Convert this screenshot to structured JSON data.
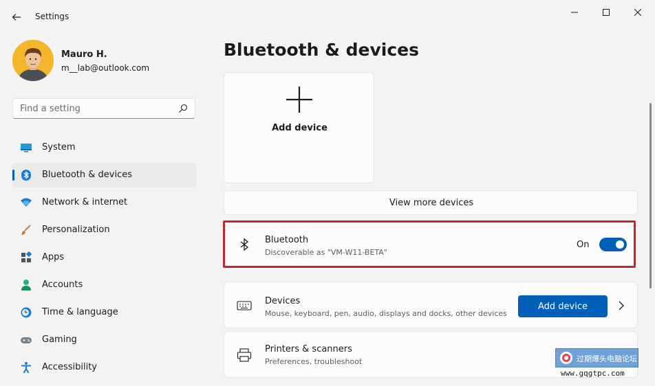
{
  "window": {
    "title": "Settings"
  },
  "profile": {
    "name": "Mauro H.",
    "email": "m__lab@outlook.com"
  },
  "search": {
    "placeholder": "Find a setting",
    "icon": "search-icon"
  },
  "nav": {
    "items": [
      {
        "label": "System",
        "icon": "monitor-icon",
        "active": false
      },
      {
        "label": "Bluetooth & devices",
        "icon": "bluetooth-icon",
        "active": true
      },
      {
        "label": "Network & internet",
        "icon": "wifi-icon",
        "active": false
      },
      {
        "label": "Personalization",
        "icon": "brush-icon",
        "active": false
      },
      {
        "label": "Apps",
        "icon": "apps-icon",
        "active": false
      },
      {
        "label": "Accounts",
        "icon": "person-icon",
        "active": false
      },
      {
        "label": "Time & language",
        "icon": "clock-globe-icon",
        "active": false
      },
      {
        "label": "Gaming",
        "icon": "gamepad-icon",
        "active": false
      },
      {
        "label": "Accessibility",
        "icon": "accessibility-icon",
        "active": false
      }
    ]
  },
  "main": {
    "title": "Bluetooth & devices",
    "add_device_tile": {
      "label": "Add device"
    },
    "view_more": "View more devices",
    "bluetooth": {
      "title": "Bluetooth",
      "subtitle": "Discoverable as \"VM-W11-BETA\"",
      "toggle_label": "On",
      "enabled": true
    },
    "devices": {
      "title": "Devices",
      "subtitle": "Mouse, keyboard, pen, audio, displays and docks, other devices",
      "button": "Add device"
    },
    "printers": {
      "title": "Printers & scanners",
      "subtitle": "Preferences, troubleshoot"
    }
  },
  "watermark": {
    "badge": "过期爆头电脑论坛",
    "url": "www.gqgtpc.com"
  },
  "colors": {
    "accent": "#005fb8",
    "highlight": "#c1272d",
    "background": "#f3f3f3"
  }
}
